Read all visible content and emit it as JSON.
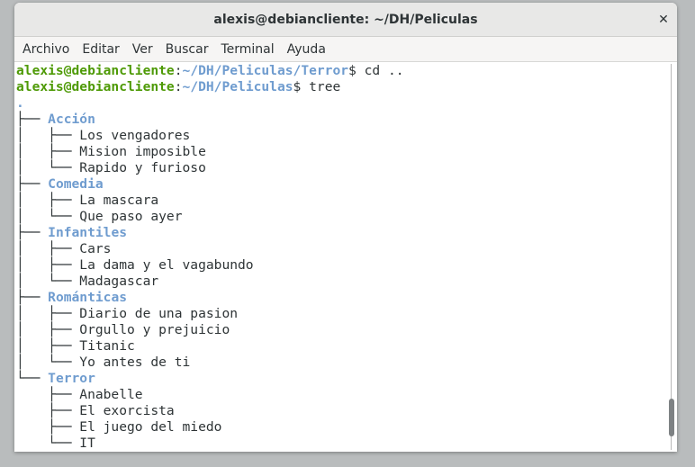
{
  "window": {
    "title": "alexis@debiancliente: ~/DH/Peliculas",
    "close_icon": "close-icon"
  },
  "menubar": {
    "items": [
      "Archivo",
      "Editar",
      "Ver",
      "Buscar",
      "Terminal",
      "Ayuda"
    ]
  },
  "colors": {
    "prompt_user": "#4e9a06",
    "prompt_path": "#6f9ccf",
    "directory": "#6f9ccf",
    "text": "#2e3436"
  },
  "terminal": {
    "lines": [
      [
        {
          "t": "alexis@debiancliente",
          "c": "user"
        },
        {
          "t": ":"
        },
        {
          "t": "~/DH/Peliculas/Terror",
          "c": "path"
        },
        {
          "t": "$ cd .."
        }
      ],
      [
        {
          "t": "alexis@debiancliente",
          "c": "user"
        },
        {
          "t": ":"
        },
        {
          "t": "~/DH/Peliculas",
          "c": "path"
        },
        {
          "t": "$ tree"
        }
      ],
      [
        {
          "t": ".",
          "c": "dir"
        }
      ],
      [
        {
          "t": "├── "
        },
        {
          "t": "Acción",
          "c": "dir"
        }
      ],
      [
        {
          "t": "│   ├── Los vengadores"
        }
      ],
      [
        {
          "t": "│   ├── Mision imposible"
        }
      ],
      [
        {
          "t": "│   └── Rapido y furioso"
        }
      ],
      [
        {
          "t": "├── "
        },
        {
          "t": "Comedia",
          "c": "dir"
        }
      ],
      [
        {
          "t": "│   ├── La mascara"
        }
      ],
      [
        {
          "t": "│   └── Que paso ayer"
        }
      ],
      [
        {
          "t": "├── "
        },
        {
          "t": "Infantiles",
          "c": "dir"
        }
      ],
      [
        {
          "t": "│   ├── Cars"
        }
      ],
      [
        {
          "t": "│   ├── La dama y el vagabundo"
        }
      ],
      [
        {
          "t": "│   └── Madagascar"
        }
      ],
      [
        {
          "t": "├── "
        },
        {
          "t": "Románticas",
          "c": "dir"
        }
      ],
      [
        {
          "t": "│   ├── Diario de una pasion"
        }
      ],
      [
        {
          "t": "│   ├── Orgullo y prejuicio"
        }
      ],
      [
        {
          "t": "│   ├── Titanic"
        }
      ],
      [
        {
          "t": "│   └── Yo antes de ti"
        }
      ],
      [
        {
          "t": "└── "
        },
        {
          "t": "Terror",
          "c": "dir"
        }
      ],
      [
        {
          "t": "    ├── Anabelle"
        }
      ],
      [
        {
          "t": "    ├── El exorcista"
        }
      ],
      [
        {
          "t": "    ├── El juego del miedo"
        }
      ],
      [
        {
          "t": "    └── IT"
        }
      ]
    ],
    "scroll_position": 0.96
  }
}
